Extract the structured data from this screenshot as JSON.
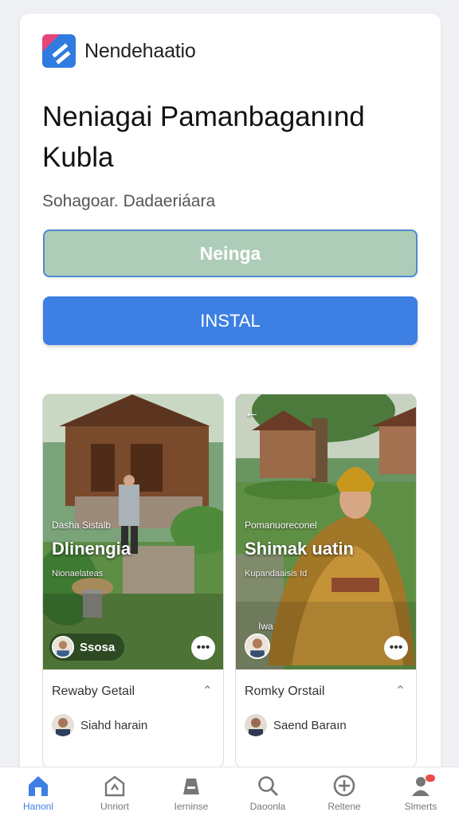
{
  "app": {
    "brand_name": "Nendehaatio",
    "title": "Neniagai Pamanbaganınd Kubla",
    "subtitle": "Sohagoar. Dadaeriáara",
    "open_label": "Neinga",
    "install_label": "INSTAL"
  },
  "colors": {
    "install": "#3d7fe3",
    "open_fill": "#aecdb8",
    "open_border": "#4e89cf",
    "nav_active": "#3d7fe3",
    "badge": "#e94b4b"
  },
  "screenshots": [
    {
      "overlay_small": "Dasha Sistalb",
      "overlay_title": "Dlinengia",
      "overlay_caption": "Nionaelateas",
      "overlay_user": "Ssosa",
      "footer_title": "Rewaby Getail",
      "footer_user": "Siahd harain"
    },
    {
      "overlay_small": "Pomanuoreconel",
      "overlay_title": "Shimak uatin",
      "overlay_caption": "Kupandaaisis Id",
      "overlay_tag": "Iwa",
      "footer_title": "Romky Orstail",
      "footer_user": "Saend Baraın"
    }
  ],
  "nav": {
    "items": [
      {
        "label": "Hanonl",
        "icon": "home-icon"
      },
      {
        "label": "Unriort",
        "icon": "store-icon"
      },
      {
        "label": "Ierninse",
        "icon": "library-icon"
      },
      {
        "label": "Daoonla",
        "icon": "search-icon"
      },
      {
        "label": "Reltene",
        "icon": "add-circle-icon"
      },
      {
        "label": "Slmerts",
        "icon": "profile-icon"
      }
    ]
  }
}
